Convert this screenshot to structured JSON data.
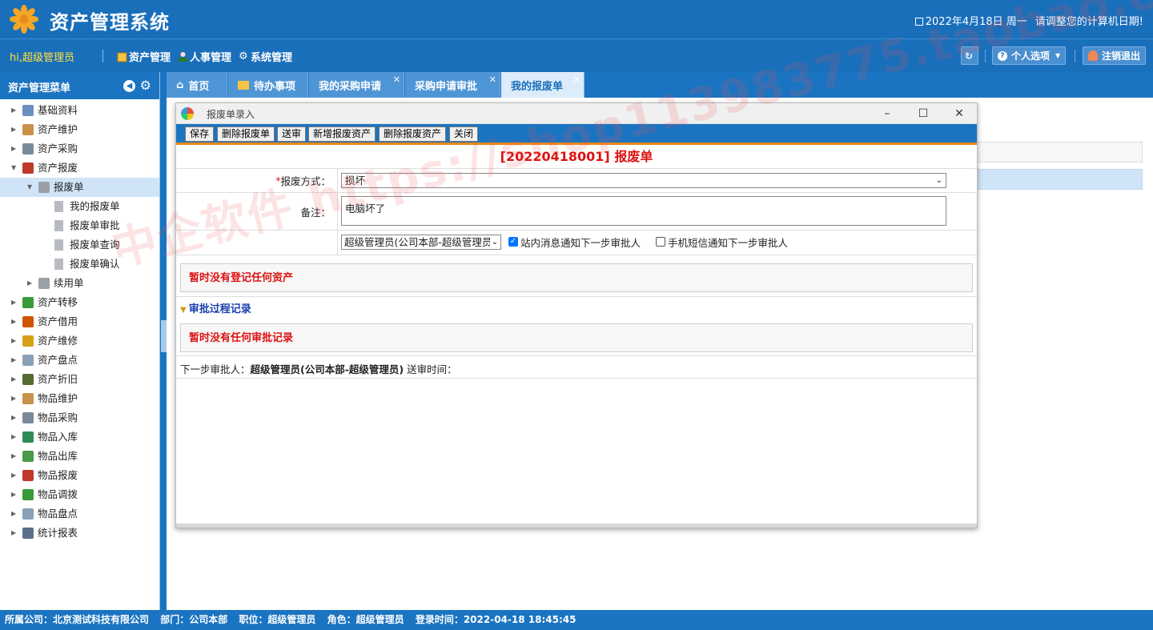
{
  "header": {
    "app_title": "资产管理系统",
    "date": "2022年4月18日 周一",
    "date_hint": "请调整您的计算机日期!"
  },
  "navbar": {
    "greeting": "hi,超级管理员",
    "menus": [
      "资产管理",
      "人事管理",
      "系统管理"
    ],
    "personal_options": "个人选项",
    "logout": "注销退出"
  },
  "sidebar": {
    "title": "资产管理菜单",
    "items": [
      {
        "label": "基础资料",
        "level": 0,
        "state": "collapsed",
        "icon": "table-icon"
      },
      {
        "label": "资产维护",
        "level": 0,
        "state": "collapsed",
        "icon": "box-icon"
      },
      {
        "label": "资产采购",
        "level": 0,
        "state": "collapsed",
        "icon": "cart-icon"
      },
      {
        "label": "资产报废",
        "level": 0,
        "state": "expanded",
        "icon": "scrap-icon"
      },
      {
        "label": "报废单",
        "level": 1,
        "state": "expanded",
        "icon": "folder-icon",
        "selected": true
      },
      {
        "label": "我的报废单",
        "level": 2,
        "state": "leaf",
        "icon": "file-icon"
      },
      {
        "label": "报废单审批",
        "level": 2,
        "state": "leaf",
        "icon": "file-icon"
      },
      {
        "label": "报废单查询",
        "level": 2,
        "state": "leaf",
        "icon": "file-icon"
      },
      {
        "label": "报废单确认",
        "level": 2,
        "state": "leaf",
        "icon": "file-icon"
      },
      {
        "label": "续用单",
        "level": 1,
        "state": "collapsed",
        "icon": "folder-icon"
      },
      {
        "label": "资产转移",
        "level": 0,
        "state": "collapsed",
        "icon": "transfer-icon"
      },
      {
        "label": "资产借用",
        "level": 0,
        "state": "collapsed",
        "icon": "borrow-icon"
      },
      {
        "label": "资产维修",
        "level": 0,
        "state": "collapsed",
        "icon": "repair-icon"
      },
      {
        "label": "资产盘点",
        "level": 0,
        "state": "collapsed",
        "icon": "inventory-icon"
      },
      {
        "label": "资产折旧",
        "level": 0,
        "state": "collapsed",
        "icon": "calculator-icon"
      },
      {
        "label": "物品维护",
        "level": 0,
        "state": "collapsed",
        "icon": "box-icon"
      },
      {
        "label": "物品采购",
        "level": 0,
        "state": "collapsed",
        "icon": "cart-icon"
      },
      {
        "label": "物品入库",
        "level": 0,
        "state": "collapsed",
        "icon": "cart-in-icon"
      },
      {
        "label": "物品出库",
        "level": 0,
        "state": "collapsed",
        "icon": "expand-icon"
      },
      {
        "label": "物品报废",
        "level": 0,
        "state": "collapsed",
        "icon": "scrap-icon"
      },
      {
        "label": "物品调拨",
        "level": 0,
        "state": "collapsed",
        "icon": "transfer-icon"
      },
      {
        "label": "物品盘点",
        "level": 0,
        "state": "collapsed",
        "icon": "inventory-icon"
      },
      {
        "label": "统计报表",
        "level": 0,
        "state": "collapsed",
        "icon": "chart-icon"
      }
    ]
  },
  "tabs": [
    {
      "label": "首页",
      "closable": false
    },
    {
      "label": "待办事项",
      "closable": false
    },
    {
      "label": "我的采购申请",
      "closable": true
    },
    {
      "label": "采购申请审批",
      "closable": true
    },
    {
      "label": "我的报废单",
      "closable": true,
      "active": true
    }
  ],
  "dialog": {
    "title": "报废单录入",
    "toolbar": [
      "保存",
      "删除报废单",
      "送审",
      "新增报废资产",
      "删除报废资产",
      "关闭"
    ],
    "heading": "[20220418001] 报废单",
    "scrap_method_label": "报废方式：",
    "scrap_method_value": "损坏",
    "remark_label": "备注：",
    "remark_value": "电脑坏了",
    "next_approver_select": "超级管理员(公司本部-超级管理员)",
    "notify_site_label": "站内消息通知下一步审批人",
    "notify_site_checked": true,
    "notify_sms_label": "手机短信通知下一步审批人",
    "notify_sms_checked": false,
    "no_assets_msg": "暂时没有登记任何资产",
    "approval_section": "审批过程记录",
    "no_approval_msg": "暂时没有任何审批记录",
    "next_approver_label": "下一步审批人：",
    "next_approver_value": "超级管理员(公司本部-超级管理员)",
    "submit_time_label": "送审时间："
  },
  "footer": {
    "company": "所属公司：北京测试科技有限公司",
    "dept": "部门：公司本部",
    "position": "职位：超级管理员",
    "role": "角色：超级管理员",
    "login_time": "登录时间：2022-04-18 18:45:45"
  },
  "watermark": "中企软件  https://shop113983775.taobao.com"
}
